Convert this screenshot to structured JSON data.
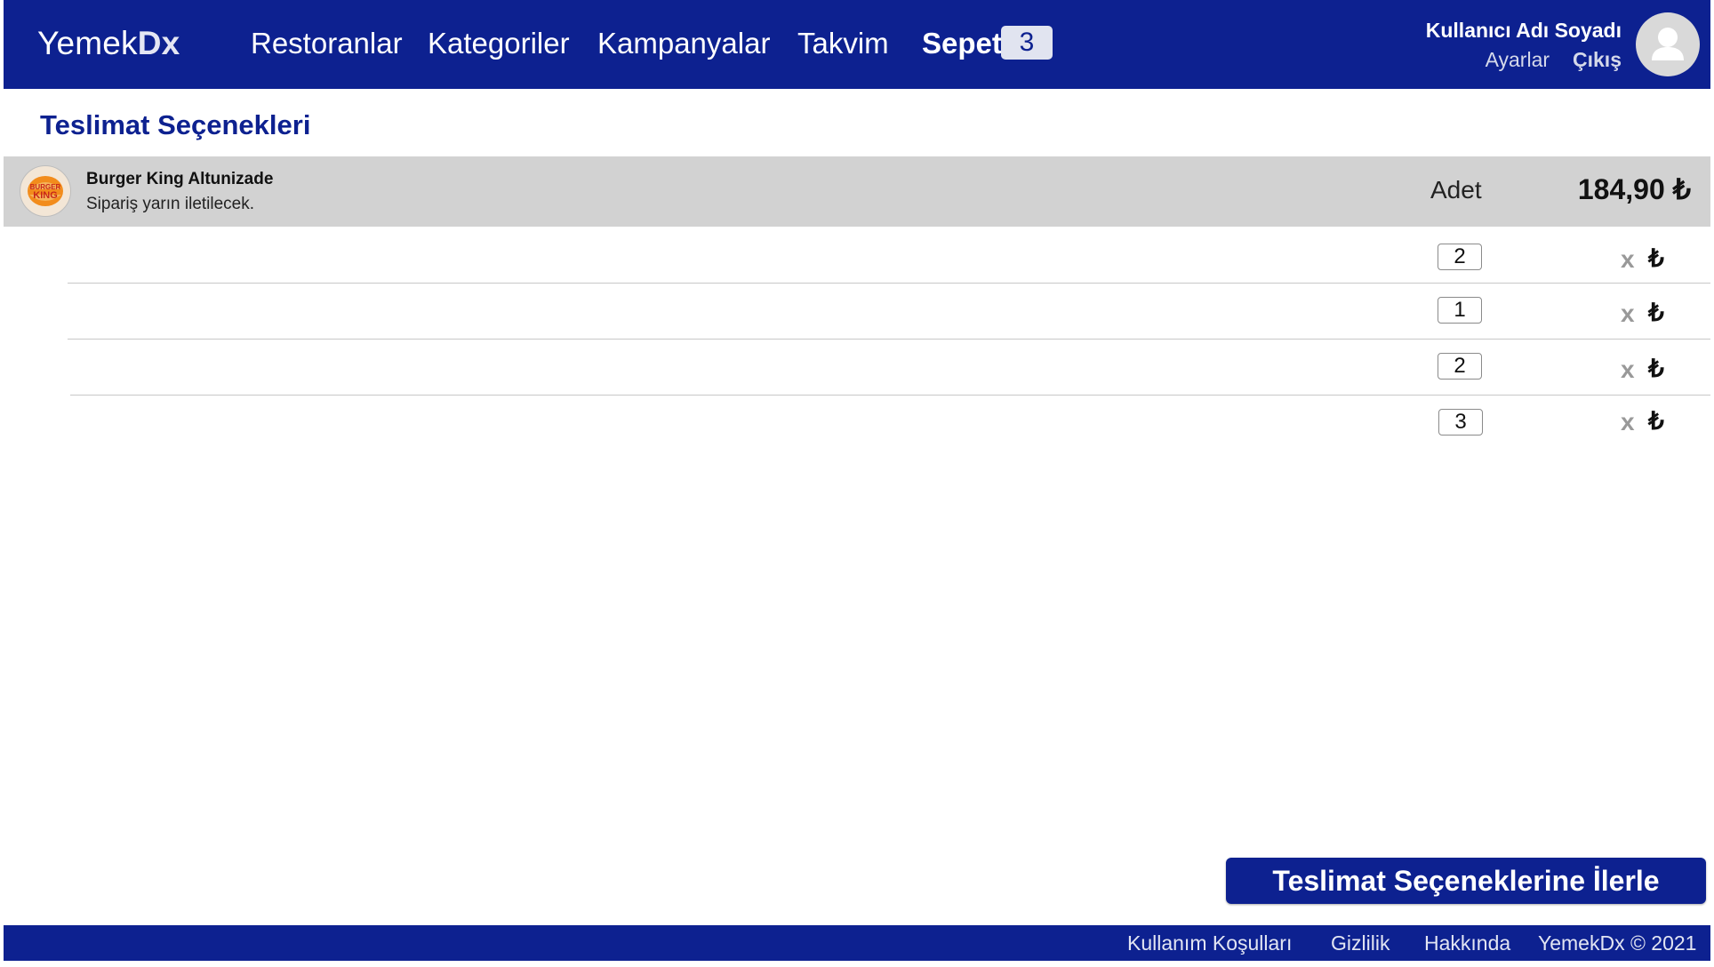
{
  "brand": {
    "prefix": "Yemek",
    "suffix": "Dx"
  },
  "nav": {
    "restaurants": "Restoranlar",
    "categories": "Kategoriler",
    "campaigns": "Kampanyalar",
    "calendar": "Takvim",
    "cart": "Sepet",
    "cart_count": "3"
  },
  "user": {
    "name": "Kullanıcı Adı Soyadı",
    "settings": "Ayarlar",
    "logout": "Çıkış"
  },
  "page": {
    "title": "Teslimat Seçenekleri"
  },
  "restaurant": {
    "name": "Burger King Altunizade",
    "note": "Sipariş yarın iletilecek.",
    "logo_text_top": "BURGER",
    "logo_text_bottom": "KING",
    "qty_header": "Adet",
    "total": "184,90 ₺"
  },
  "items": [
    {
      "qty": "2",
      "remove": "x",
      "currency": "₺"
    },
    {
      "qty": "1",
      "remove": "x",
      "currency": "₺"
    },
    {
      "qty": "2",
      "remove": "x",
      "currency": "₺"
    },
    {
      "qty": "3",
      "remove": "x",
      "currency": "₺"
    }
  ],
  "proceed_button": "Teslimat Seçeneklerine İlerle",
  "footer": {
    "terms": "Kullanım Koşulları",
    "privacy": "Gizlilik",
    "about": "Hakkında",
    "copyright": "YemekDx © 2021"
  },
  "colors": {
    "primary": "#0d2190",
    "restaurant_bar": "#d2d2d2",
    "avatar": "#d9d9d9"
  },
  "icons": {
    "avatar": "user-icon",
    "logo": "burger-king-logo"
  }
}
